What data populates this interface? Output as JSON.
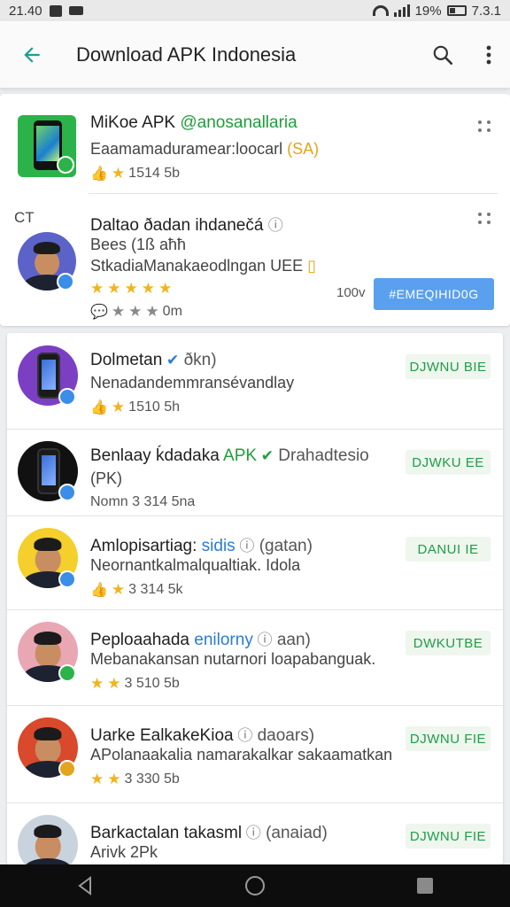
{
  "status_bar": {
    "time": "21.40",
    "battery": "19%",
    "right_text": "7.3.1"
  },
  "app_bar": {
    "title": "Download APK Indonesia",
    "back_icon": "arrow-back-icon",
    "search_icon": "search-icon",
    "more_icon": "more-vert-icon"
  },
  "featured": {
    "item1": {
      "title": "MiKoe APK",
      "handle": "@anosanallaria",
      "subtitle": "Eaamamaduramear:loocarl",
      "subtitle_accent": "(SA)",
      "rating_text": "1514 5b"
    },
    "side_label": "CT",
    "item2": {
      "title": "Daltao ðadan ihdanečá",
      "line2": "Bees (1ß aħħ",
      "line3": "StkadiaManakaeodlngan UEE",
      "review_text": "0m",
      "size_text": "100v",
      "button_label": "#EMEQIHID0G"
    }
  },
  "list": [
    {
      "title": "Dolmetan",
      "title_suffix": "ðkn)",
      "title_accent": "",
      "subtitle": "Nenadandemmransévandlay",
      "meta": "1510 5h",
      "button": "DJWNU BIE",
      "avatar_color": "#7b3fc4",
      "badge": "blue"
    },
    {
      "title": "Benlaay ḱdadaka",
      "title_accent": "APK",
      "title_suffix": "Drahadtesio",
      "subtitle": "(PK)",
      "meta": "Nomn 3 314 5na",
      "button": "DJWKU EE",
      "avatar_color": "#111111",
      "badge": "blue"
    },
    {
      "title": "Amlopisartiag:",
      "title_accent": "sidis",
      "title_suffix": "(gatan)",
      "subtitle": "Neornantkalmalqualtiak. Idola",
      "meta": "3 314 5k",
      "button": "DANUI IE",
      "avatar_color": "#f5cf2b",
      "badge": "blue"
    },
    {
      "title": "Peploaahada",
      "title_accent": "enilorny",
      "title_suffix": "aan)",
      "subtitle": "Mebanakansan nutarnori loapabanguak.",
      "meta": "3 510 5b",
      "button": "DWKUTBE",
      "avatar_color": "#e9a6b3",
      "badge": "green"
    },
    {
      "title": "Uarke EalkakeKioa",
      "title_accent": "",
      "title_suffix": "daoars)",
      "subtitle": "APolanaakalia namarakalkar sakaamatkan",
      "meta": "3 330 5b",
      "button": "DJWNU FIE",
      "avatar_color": "#d9492b",
      "badge": "yellow"
    },
    {
      "title": "Barkactalan takasml",
      "title_accent": "",
      "title_suffix": "(anaiad)",
      "subtitle": "Arivk 2Pk",
      "meta": "",
      "button": "DJWNU FIE",
      "avatar_color": "#c9d3dd",
      "badge": "none"
    }
  ],
  "nav_bar": {
    "back": "nav-back-icon",
    "home": "nav-home-icon",
    "recents": "nav-recents-icon"
  },
  "colors": {
    "accent_teal": "#1a9e8f",
    "download_green": "#1f9d47",
    "primary_blue": "#5aa0ef",
    "star_gold": "#f2b41c"
  }
}
